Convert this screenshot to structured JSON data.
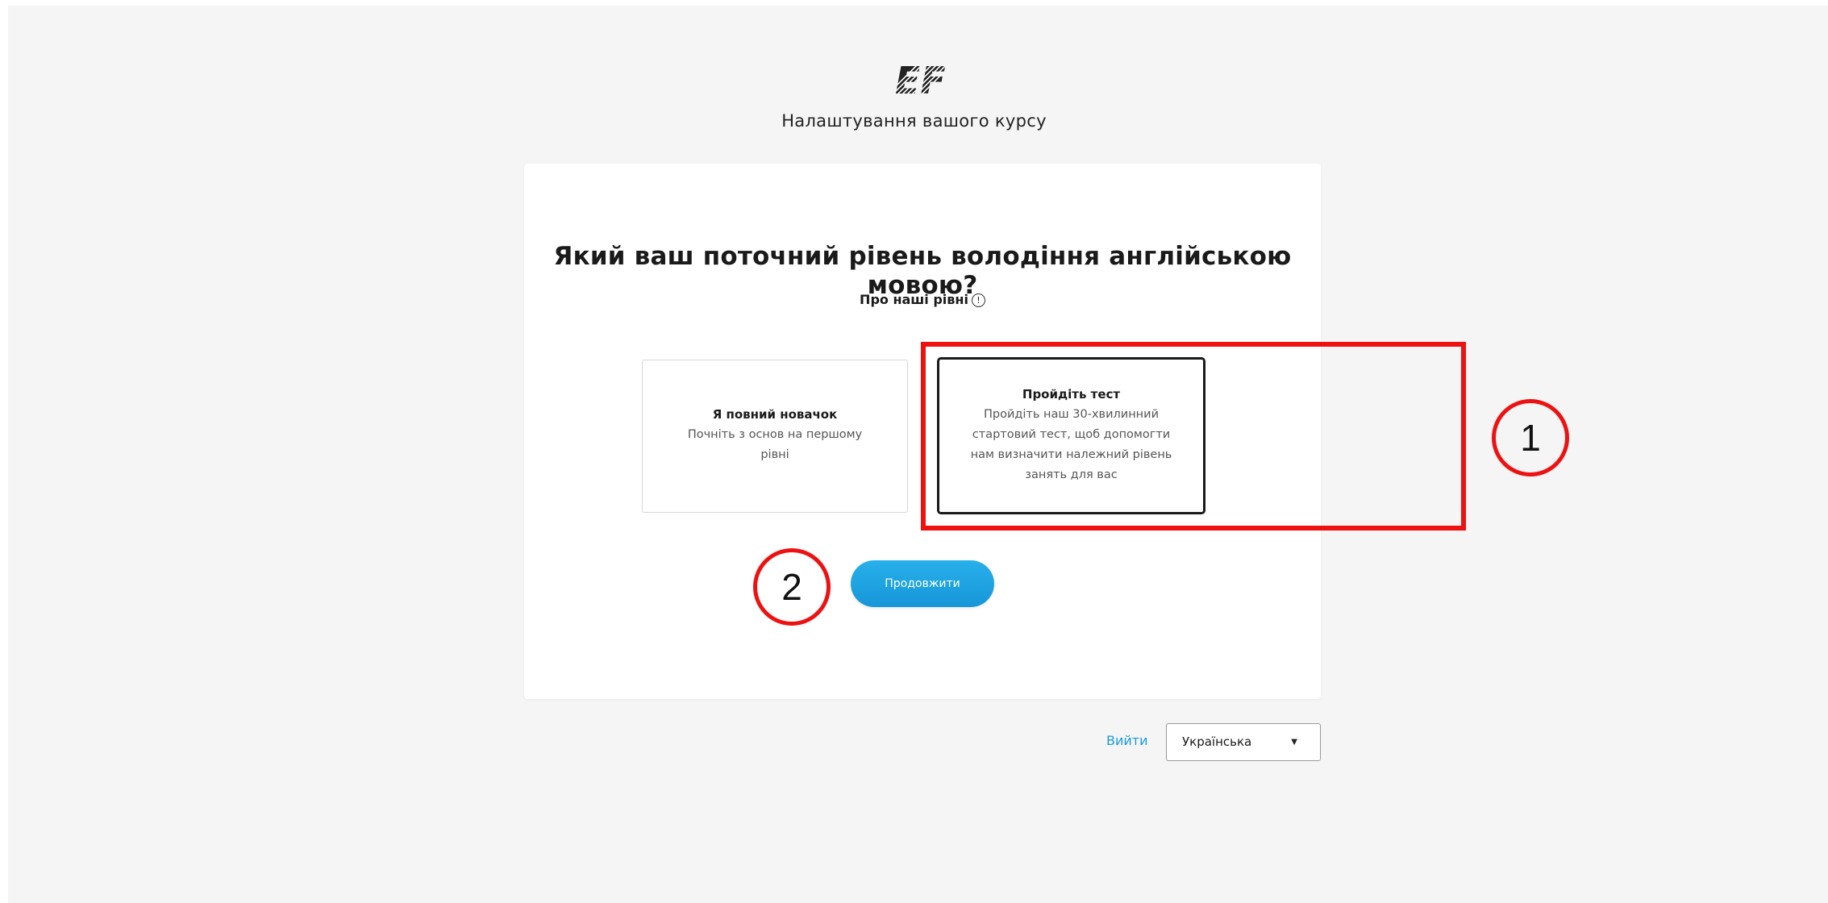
{
  "header": {
    "logo_text": "EF",
    "subtitle": "Налаштування вашого курсу"
  },
  "main": {
    "question": "Який ваш поточний рівень володіння англійською мовою?",
    "about_levels_label": "Про наші рівні",
    "about_levels_icon": "info-icon",
    "options": [
      {
        "title": "Я повний новачок",
        "description": "Почніть з основ на першому рівні",
        "selected": false
      },
      {
        "title": "Пройдіть тест",
        "description": "Пройдіть наш 30-хвилинний стартовий тест, щоб допомогти нам визначити належний рівень занять для вас",
        "selected": true
      }
    ],
    "continue_label": "Продовжити"
  },
  "footer": {
    "logout_label": "Вийти",
    "language_selected": "Українська"
  },
  "annotations": {
    "marker_1": "1",
    "marker_2": "2",
    "color": "#ee1111"
  },
  "colors": {
    "accent": "#1b9bd8",
    "button": "#1ea3e0",
    "background": "#f5f5f5"
  }
}
